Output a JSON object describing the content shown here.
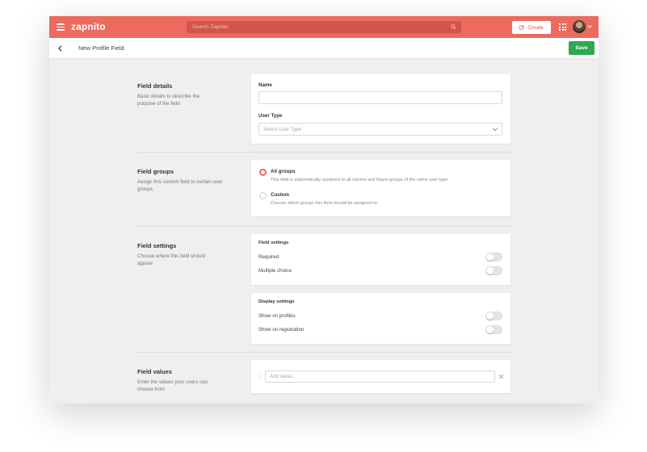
{
  "app": {
    "brand": "zapnito",
    "search_placeholder": "Search Zapnito",
    "create_label": "Create",
    "accent_color": "#ec6a5e",
    "save_color": "#2ea952"
  },
  "page": {
    "title": "New Profile Field",
    "save_label": "Save"
  },
  "sections": {
    "details": {
      "title": "Field details",
      "description": "Basic details to describe the purpose of the field",
      "name_label": "Name",
      "name_value": "",
      "user_type_label": "User Type",
      "user_type_placeholder": "Select User Type"
    },
    "groups": {
      "title": "Field groups",
      "description": "Assign this custom field to certain user groups",
      "options": [
        {
          "title": "All groups",
          "description": "This field is automatically assigned to all current and future groups of the same user type",
          "selected": true
        },
        {
          "title": "Custom",
          "description": "Choose which groups this field should be assigned to",
          "selected": false
        }
      ]
    },
    "settings": {
      "title": "Field settings",
      "description": "Choose where this field should appear",
      "field_settings_heading": "Field settings",
      "field_settings": [
        {
          "label": "Required",
          "on": false
        },
        {
          "label": "Multiple choice",
          "on": false
        }
      ],
      "display_settings_heading": "Display settings",
      "display_settings": [
        {
          "label": "Show on profiles",
          "on": false
        },
        {
          "label": "Show on registration",
          "on": false
        }
      ]
    },
    "values": {
      "title": "Field values",
      "description": "Enter the values your users can choose from",
      "add_placeholder": "Add value..."
    }
  },
  "icons": [
    "menu-icon",
    "search-icon",
    "edit-icon",
    "apps-grid-icon",
    "chevron-down-icon",
    "back-arrow-icon",
    "drag-handle-icon",
    "close-icon"
  ]
}
